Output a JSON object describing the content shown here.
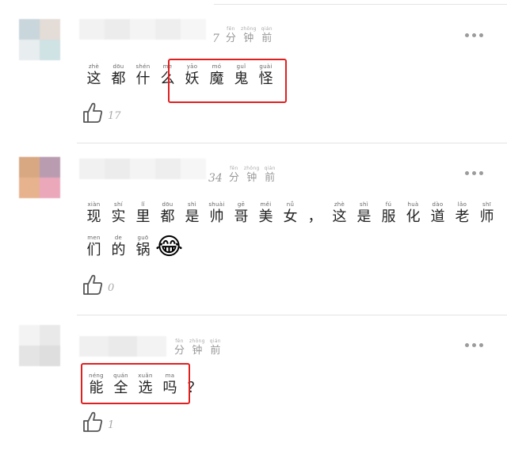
{
  "comments": [
    {
      "time": {
        "num": "7",
        "units": [
          {
            "py": "fēn",
            "hz": "分"
          },
          {
            "py": "zhōng",
            "hz": "钟"
          },
          {
            "py": "qián",
            "hz": "前"
          }
        ]
      },
      "lines": [
        [
          {
            "py": "zhè",
            "hz": "这"
          },
          {
            "py": "dōu",
            "hz": "都"
          },
          {
            "py": "shén",
            "hz": "什"
          },
          {
            "py": "me",
            "hz": "么"
          },
          {
            "py": "yāo",
            "hz": "妖"
          },
          {
            "py": "mó",
            "hz": "魔"
          },
          {
            "py": "guǐ",
            "hz": "鬼"
          },
          {
            "py": "guài",
            "hz": "怪"
          }
        ]
      ],
      "likes": "17"
    },
    {
      "time": {
        "num": "34",
        "units": [
          {
            "py": "fēn",
            "hz": "分"
          },
          {
            "py": "zhōng",
            "hz": "钟"
          },
          {
            "py": "qián",
            "hz": "前"
          }
        ]
      },
      "lines": [
        [
          {
            "py": "xiàn",
            "hz": "现"
          },
          {
            "py": "shí",
            "hz": "实"
          },
          {
            "py": "lǐ",
            "hz": "里"
          },
          {
            "py": "dōu",
            "hz": "都"
          },
          {
            "py": "shì",
            "hz": "是"
          },
          {
            "py": "shuài",
            "hz": "帅"
          },
          {
            "py": "gē",
            "hz": "哥"
          },
          {
            "py": "měi",
            "hz": "美"
          },
          {
            "py": "nǚ",
            "hz": "女"
          },
          {
            "py": "",
            "hz": "，"
          },
          {
            "py": "zhè",
            "hz": "这"
          },
          {
            "py": "shì",
            "hz": "是"
          },
          {
            "py": "fú",
            "hz": "服"
          },
          {
            "py": "huà",
            "hz": "化"
          },
          {
            "py": "dào",
            "hz": "道"
          },
          {
            "py": "lǎo",
            "hz": "老"
          },
          {
            "py": "shī",
            "hz": "师"
          }
        ],
        [
          {
            "py": "men",
            "hz": "们"
          },
          {
            "py": "de",
            "hz": "的"
          },
          {
            "py": "guō",
            "hz": "锅"
          }
        ]
      ],
      "emoji": "😂",
      "likes": "0"
    },
    {
      "time": {
        "num": "",
        "units": [
          {
            "py": "fēn",
            "hz": "分"
          },
          {
            "py": "zhōng",
            "hz": "钟"
          },
          {
            "py": "qián",
            "hz": "前"
          }
        ]
      },
      "lines": [
        [
          {
            "py": "néng",
            "hz": "能"
          },
          {
            "py": "quán",
            "hz": "全"
          },
          {
            "py": "xuǎn",
            "hz": "选"
          },
          {
            "py": "ma",
            "hz": "吗"
          },
          {
            "py": "",
            "hz": "？"
          }
        ]
      ],
      "likes": "1"
    }
  ]
}
